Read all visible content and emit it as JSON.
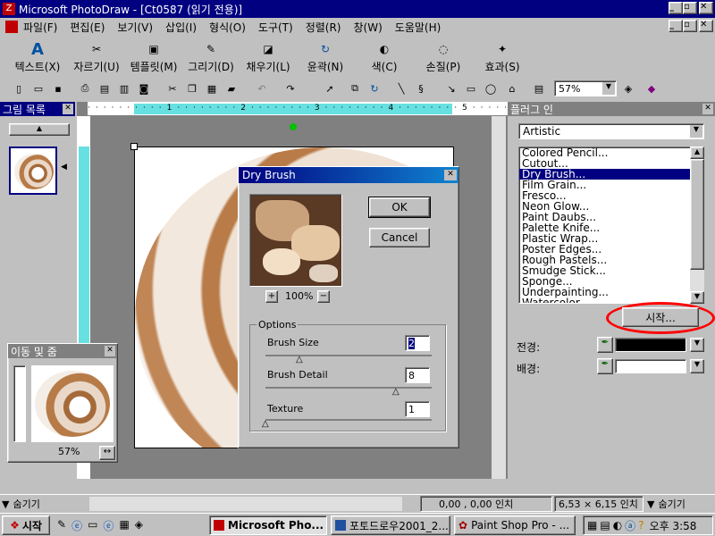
{
  "window": {
    "title": "Microsoft PhotoDraw - [Ct0587 (읽기 전용)]"
  },
  "menu": [
    "파일(F)",
    "편집(E)",
    "보기(V)",
    "삽입(I)",
    "형식(O)",
    "도구(T)",
    "정렬(R)",
    "창(W)",
    "도움말(H)"
  ],
  "big_toolbar": [
    "텍스트(X)",
    "자르기(U)",
    "템플릿(M)",
    "그리기(D)",
    "채우기(L)",
    "윤곽(N)",
    "색(C)",
    "손질(P)",
    "효과(S)"
  ],
  "zoom": "57%",
  "left_pane": {
    "title": "그림 목록"
  },
  "nav_pane": {
    "title": "이동 및 줌",
    "zoom": "57%"
  },
  "plugin": {
    "title": "플러그 인",
    "category": "Artistic",
    "items": [
      "Colored Pencil...",
      "Cutout...",
      "Dry Brush...",
      "Film Grain...",
      "Fresco...",
      "Neon Glow...",
      "Paint Daubs...",
      "Palette Knife...",
      "Plastic Wrap...",
      "Poster Edges...",
      "Rough Pastels...",
      "Smudge Stick...",
      "Sponge...",
      "Underpainting...",
      "Watercolor..."
    ],
    "selected_index": 2,
    "start_button": "시작...",
    "foreground_label": "전경:",
    "background_label": "배경:",
    "foreground_color": "#000000",
    "background_color": "#ffffff"
  },
  "dialog": {
    "title": "Dry Brush",
    "ok": "OK",
    "cancel": "Cancel",
    "preview_zoom": "100%",
    "options_label": "Options",
    "brush_size_label": "Brush Size",
    "brush_size": "2",
    "brush_detail_label": "Brush Detail",
    "brush_detail": "8",
    "texture_label": "Texture",
    "texture": "1"
  },
  "status": {
    "hide_left": "숨기기",
    "position": "0,00 , 0,00 인치",
    "size": "6,53 × 6,15 인치",
    "hide_right": "숨기기"
  },
  "taskbar": {
    "start": "시작",
    "tasks": [
      "Microsoft Pho...",
      "포토드로우2001_2...",
      "Paint Shop Pro - ..."
    ],
    "clock": "오후 3:58"
  },
  "colors": {
    "accent": "#000080",
    "ruler": "#66e0e0",
    "highlight": "#ff0000"
  }
}
